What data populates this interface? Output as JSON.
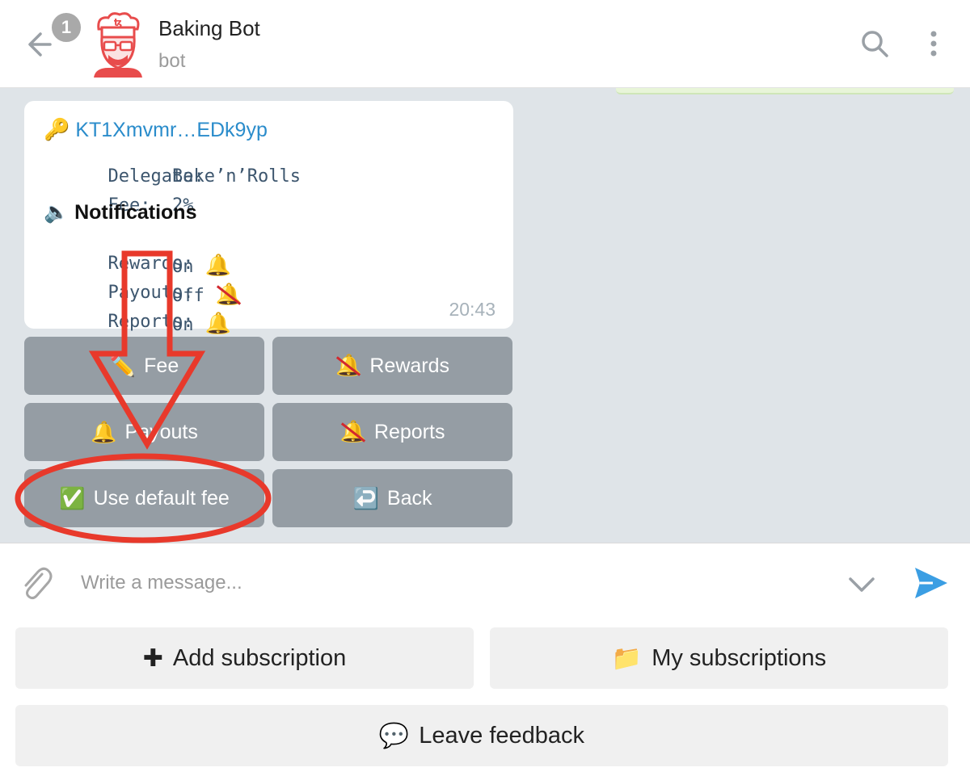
{
  "header": {
    "unread_count": "1",
    "title": "Baking Bot",
    "subtitle": "bot"
  },
  "message": {
    "link_icon": "key-icon",
    "address": "KT1Xmvmr…EDk9yp",
    "delegate_label": "Delegate:",
    "delegate_value": "Bake’n’Rolls",
    "fee_label": "Fee:",
    "fee_value": "2%",
    "notifications_title": "Notifications",
    "rewards_label": "Rewards:",
    "rewards_value": "On",
    "payouts_label": "Payouts:",
    "payouts_value": "Off",
    "reports_label": "Reports:",
    "reports_value": "On",
    "time": "20:43"
  },
  "inline_keyboard": {
    "fee": "Fee",
    "rewards": "Rewards",
    "payouts": "Payouts",
    "reports": "Reports",
    "use_default_fee": "Use default fee",
    "back": "Back"
  },
  "composer": {
    "placeholder": "Write a message..."
  },
  "reply_keyboard": {
    "add_subscription": "Add subscription",
    "my_subscriptions": "My subscriptions",
    "leave_feedback": "Leave feedback"
  },
  "colors": {
    "accent_link": "#2a8ccb",
    "annotation": "#e8392b",
    "keyboard_button": "#959da4",
    "send": "#3b9ee3"
  }
}
